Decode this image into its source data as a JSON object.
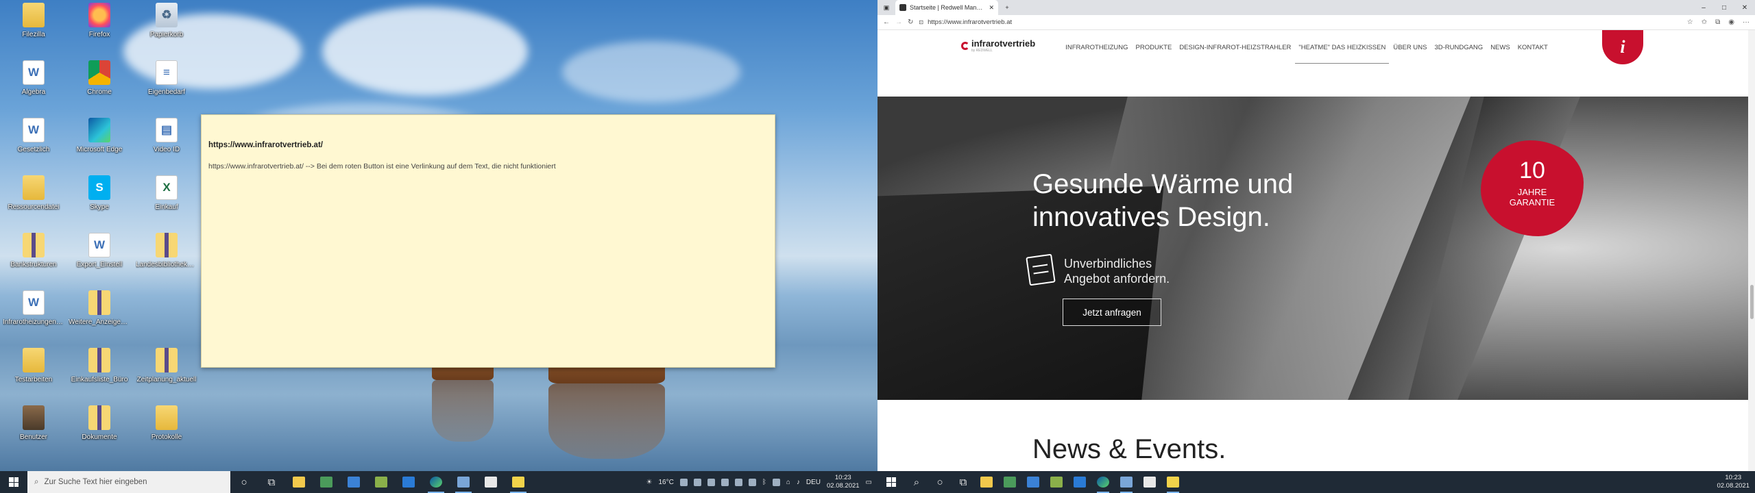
{
  "desktop": {
    "icons": [
      {
        "label": "Filezilla",
        "glyph": "",
        "kind": "folder"
      },
      {
        "label": "Firefox",
        "glyph": "",
        "kind": "firefox"
      },
      {
        "label": "Papierkorb",
        "glyph": "♻",
        "kind": "bin"
      },
      {
        "label": "Algebra",
        "glyph": "W",
        "kind": "doc"
      },
      {
        "label": "Chrome",
        "glyph": "",
        "kind": "chrome"
      },
      {
        "label": "Eigenbedarf",
        "glyph": "≡",
        "kind": "doc"
      },
      {
        "label": "Gesetzlich",
        "glyph": "W",
        "kind": "doc"
      },
      {
        "label": "Microsoft Edge",
        "glyph": "",
        "kind": "edge"
      },
      {
        "label": "Video ID",
        "glyph": "▤",
        "kind": "doc"
      },
      {
        "label": "Ressourcendatei",
        "glyph": "",
        "kind": "folder"
      },
      {
        "label": "Skype",
        "glyph": "S",
        "kind": "skype"
      },
      {
        "label": "Einkauf",
        "glyph": "X",
        "kind": "excel"
      },
      {
        "label": "Bankstrukturen",
        "glyph": "",
        "kind": "zip"
      },
      {
        "label": "Export_Einstell",
        "glyph": "W",
        "kind": "doc"
      },
      {
        "label": "Landesbibliothek_Sa...",
        "glyph": "",
        "kind": "zip"
      },
      {
        "label": "Infrarotheizungen_Sch...",
        "glyph": "W",
        "kind": "doc"
      },
      {
        "label": "Weitere_Anzeigen_Ltd",
        "glyph": "",
        "kind": "zip"
      },
      {
        "label": "Testarbeiten",
        "glyph": "",
        "kind": "folder"
      },
      {
        "label": "Einkaufsliste_Büro",
        "glyph": "",
        "kind": "zip"
      },
      {
        "label": "Zeitplanung_aktuell",
        "glyph": "",
        "kind": "zip"
      },
      {
        "label": "Benutzer",
        "glyph": "",
        "kind": "user"
      },
      {
        "label": "Dokumente",
        "glyph": "",
        "kind": "zip"
      },
      {
        "label": "Protokolle",
        "glyph": "",
        "kind": "folder"
      }
    ]
  },
  "note": {
    "title": "https://www.infrarotvertrieb.at/",
    "body": "https://www.infrarotvertrieb.at/ --> Bei dem roten Button ist eine Verlinkung auf dem Text, die nicht funktioniert"
  },
  "taskbar_left": {
    "search_placeholder": "Zur Suche Text hier eingeben",
    "weather": "16°C",
    "language": "DEU",
    "time": "10:23",
    "date": "02.08.2021"
  },
  "browser": {
    "tab_title": "Startseite | Redwell Manufaktur G...",
    "url": "https://www.infrarotvertrieb.at",
    "icons": {
      "back": "←",
      "forward": "→",
      "refresh": "↻",
      "lock": "🔒",
      "new_tab": "+",
      "minimize": "–",
      "maximize": "□",
      "close": "✕",
      "more": "···"
    }
  },
  "site": {
    "logo": "infrarotvertrieb",
    "logo_sub": "by REDWELL",
    "nav": [
      "INFRAROTHEIZUNG",
      "PRODUKTE",
      "DESIGN-INFRAROT-HEIZSTRAHLER",
      "\"HEATME\" DAS HEIZKISSEN",
      "ÜBER UNS",
      "3D-RUNDGANG",
      "NEWS",
      "KONTAKT"
    ],
    "info_button": "i",
    "hero_title_1": "Gesunde Wärme und",
    "hero_title_2": "innovatives Design.",
    "hero_sub_1": "Unverbindliches",
    "hero_sub_2": "Angebot anfordern.",
    "cta": "Jetzt anfragen",
    "badge_num": "10",
    "badge_line1": "JAHRE",
    "badge_line2": "GARANTIE",
    "news_heading": "News & Events."
  },
  "taskbar_right": {
    "time": "10:23",
    "date": "02.08.2021"
  },
  "colors": {
    "brand_red": "#c8102e",
    "taskbar": "#1f2a36",
    "note_bg": "#fff8d2"
  }
}
